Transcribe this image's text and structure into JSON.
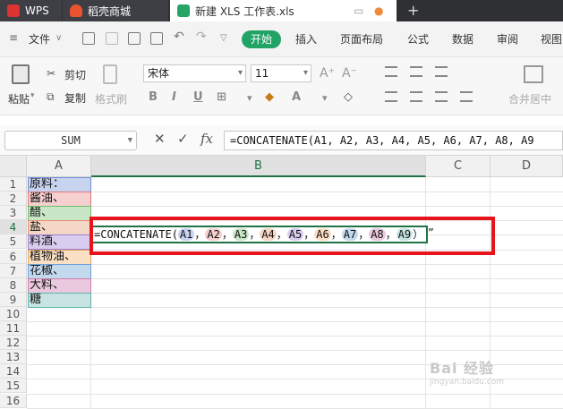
{
  "titlebar": {
    "tabs": [
      {
        "label": "WPS",
        "icon": "wps-logo-icon"
      },
      {
        "label": "稻壳商城",
        "icon": "docer-icon"
      },
      {
        "label": "新建 XLS 工作表.xls",
        "icon": "xls-icon"
      }
    ],
    "new_tab": "+"
  },
  "menubar": {
    "file": "文件",
    "items": [
      "开始",
      "插入",
      "页面布局",
      "公式",
      "数据",
      "审阅",
      "视图"
    ],
    "active": "开始"
  },
  "ribbon": {
    "paste": "粘贴",
    "cut": "剪切",
    "copy": "复制",
    "format_painter": "格式刷",
    "font_name": "宋体",
    "font_size": "11",
    "merge_center": "合并居中"
  },
  "formula_bar": {
    "name_box": "SUM",
    "cancel": "✕",
    "confirm": "✓",
    "fx": "fx",
    "formula": "=CONCATENATE(A1, A2, A3, A4, A5, A6, A7, A8, A9"
  },
  "sheet": {
    "columns": [
      "A",
      "B",
      "C",
      "D"
    ],
    "active_column": "B",
    "rows": [
      "1",
      "2",
      "3",
      "4",
      "5",
      "6",
      "7",
      "8",
      "9",
      "10",
      "11",
      "12",
      "13",
      "14",
      "15",
      "16"
    ],
    "active_row": "4",
    "column_a": [
      "原料：",
      "酱油、",
      "醋、",
      "盐、",
      "料酒、",
      "植物油、",
      "花椒、",
      "大料、",
      "糖"
    ],
    "edit_cell": {
      "prefix": "=CONCATENATE(",
      "refs": [
        "A1",
        "A2",
        "A3",
        "A4",
        "A5",
        "A6",
        "A7",
        "A8",
        "A9"
      ],
      "separator": "，",
      "suffix": "）"
    },
    "overflow_text": "”",
    "ref_colors": [
      "#c7d3ef",
      "#f6cfcf",
      "#c9e6c7",
      "#f4d6c6",
      "#d8cdee",
      "#fbe0c5",
      "#c3d9ee",
      "#eac9de",
      "#c8e4e2"
    ],
    "box_colors": [
      "#6c8fd6",
      "#e07a7a",
      "#6cbf6a",
      "#e38f6a",
      "#9d7fd3",
      "#e9a55a",
      "#6aa2d6",
      "#d27aad",
      "#5fb3ad"
    ]
  },
  "watermark": {
    "text": "Bai 经验",
    "sub": "jingyan.baidu.com"
  }
}
